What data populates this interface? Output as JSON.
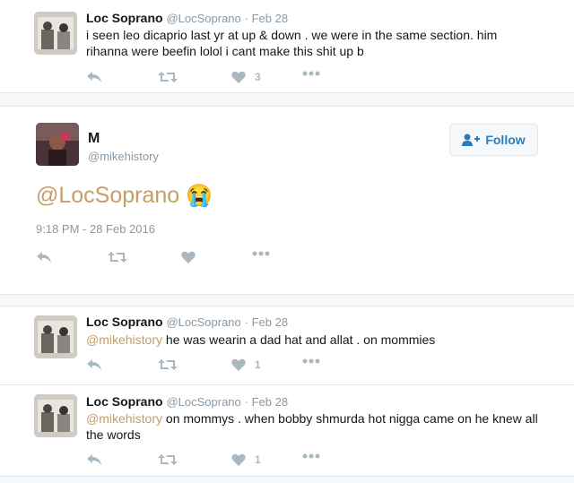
{
  "reply_top": {
    "name": "Loc Soprano",
    "handle": "@LocSoprano",
    "date": "· Feb 28",
    "text": "i seen leo dicaprio last yr at up & down . we were in the same section. him rihanna were beefin lolol i cant make this shit up b",
    "likes": "3"
  },
  "main": {
    "name": "M",
    "handle": "@mikehistory",
    "follow_label": "Follow",
    "text": "@LocSoprano",
    "emoji": "😭",
    "timestamp": "9:18 PM - 28 Feb 2016"
  },
  "replies": [
    {
      "name": "Loc Soprano",
      "handle": "@LocSoprano",
      "date": "· Feb 28",
      "mention": "@mikehistory",
      "text": " he was wearin a dad hat and allat . on mommies",
      "likes": "1"
    },
    {
      "name": "Loc Soprano",
      "handle": "@LocSoprano",
      "date": "· Feb 28",
      "mention": "@mikehistory",
      "text": " on mommys . when bobby shmurda hot nigga came on he knew all the words",
      "likes": "1"
    }
  ],
  "colors": {
    "accent": "#c59e63",
    "link": "#2b7bb9",
    "muted": "#8899a6",
    "icon": "#aab8c2"
  }
}
